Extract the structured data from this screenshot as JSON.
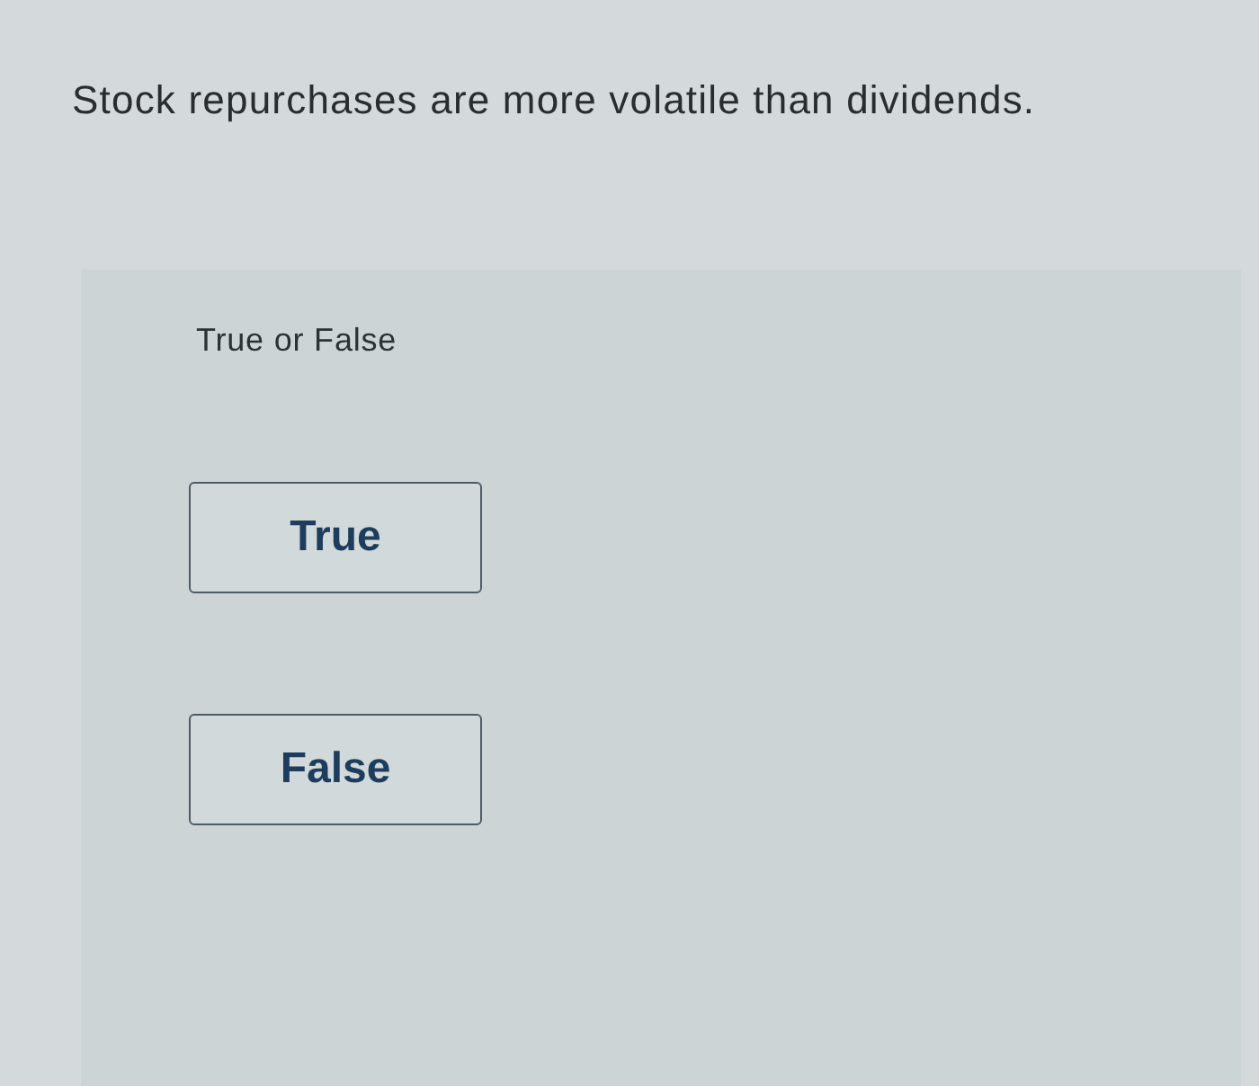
{
  "question": {
    "text": "Stock repurchases are more volatile than dividends."
  },
  "answer_area": {
    "instruction": "True or False",
    "options": [
      {
        "label": "True",
        "selected": false
      },
      {
        "label": "False",
        "selected": false
      }
    ]
  }
}
